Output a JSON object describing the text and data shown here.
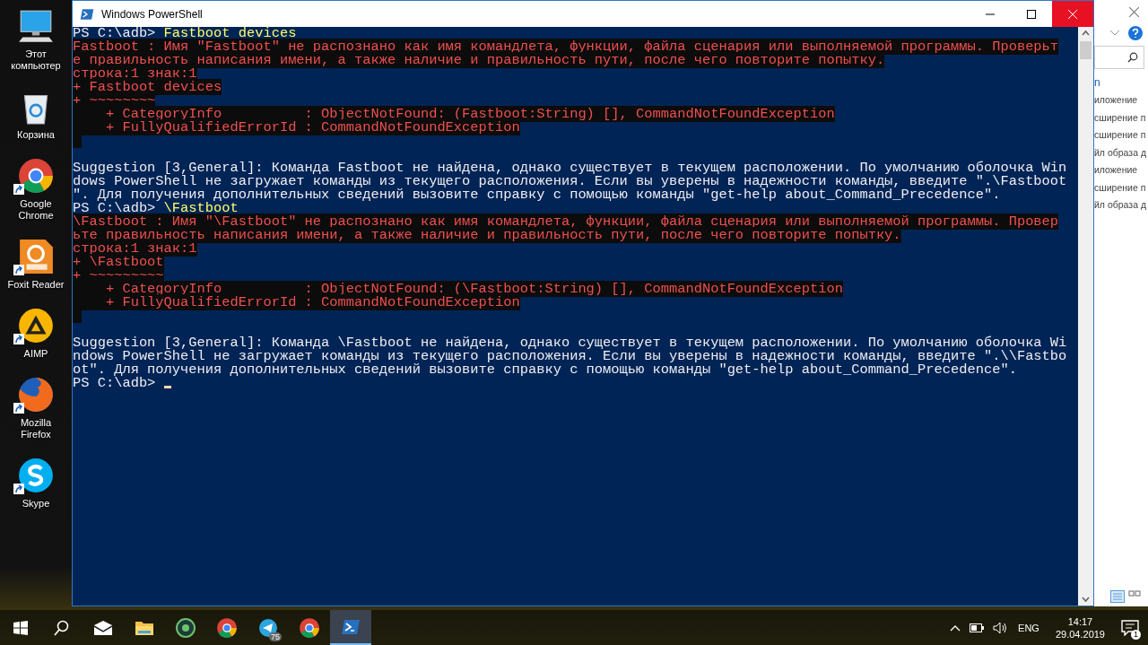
{
  "desktop": {
    "icons": [
      {
        "label": "Этот компьютер",
        "kind": "computer",
        "shortcut": false
      },
      {
        "label": "Корзина",
        "kind": "recycle",
        "shortcut": false
      },
      {
        "label": "Google Chrome",
        "kind": "chrome",
        "shortcut": true
      },
      {
        "label": "Foxit Reader",
        "kind": "pdf",
        "shortcut": true
      },
      {
        "label": "AIMP",
        "kind": "aimp",
        "shortcut": true
      },
      {
        "label": "Mozilla Firefox",
        "kind": "firefox",
        "shortcut": true
      },
      {
        "label": "Skype",
        "kind": "skype",
        "shortcut": true
      }
    ]
  },
  "window": {
    "title": "Windows PowerShell"
  },
  "console": {
    "lines": [
      {
        "kind": "prompt",
        "prompt": "PS C:\\adb>",
        "command": "Fastboot devices"
      },
      {
        "kind": "error",
        "text": "Fastboot : Имя \"Fastboot\" не распознано как имя командлета, функции, файла сценария или выполняемой программы. Проверьт"
      },
      {
        "kind": "error",
        "text": "е правильность написания имени, а также наличие и правильность пути, после чего повторите попытку."
      },
      {
        "kind": "error",
        "text": "строка:1 знак:1"
      },
      {
        "kind": "error",
        "text": "+ Fastboot devices"
      },
      {
        "kind": "error",
        "text": "+ ~~~~~~~~"
      },
      {
        "kind": "error",
        "text": "    + CategoryInfo          : ObjectNotFound: (Fastboot:String) [], CommandNotFoundException"
      },
      {
        "kind": "error",
        "text": "    + FullyQualifiedErrorId : CommandNotFoundException"
      },
      {
        "kind": "error-gap"
      },
      {
        "kind": "blank"
      },
      {
        "kind": "output",
        "text": "Suggestion [3,General]: Команда Fastboot не найдена, однако существует в текущем расположении. По умолчанию оболочка Win"
      },
      {
        "kind": "output",
        "text": "dows PowerShell не загружает команды из текущего расположения. Если вы уверены в надежности команды, введите \".\\Fastboot"
      },
      {
        "kind": "output",
        "text": "\". Для получения дополнительных сведений вызовите справку с помощью команды \"get-help about_Command_Precedence\"."
      },
      {
        "kind": "prompt",
        "prompt": "PS C:\\adb>",
        "command": "\\Fastboot"
      },
      {
        "kind": "error",
        "text": "\\Fastboot : Имя \"\\Fastboot\" не распознано как имя командлета, функции, файла сценария или выполняемой программы. Провер"
      },
      {
        "kind": "error",
        "text": "ьте правильность написания имени, а также наличие и правильность пути, после чего повторите попытку."
      },
      {
        "kind": "error",
        "text": "строка:1 знак:1"
      },
      {
        "kind": "error",
        "text": "+ \\Fastboot"
      },
      {
        "kind": "error",
        "text": "+ ~~~~~~~~~"
      },
      {
        "kind": "error",
        "text": "    + CategoryInfo          : ObjectNotFound: (\\Fastboot:String) [], CommandNotFoundException"
      },
      {
        "kind": "error",
        "text": "    + FullyQualifiedErrorId : CommandNotFoundException"
      },
      {
        "kind": "error-gap"
      },
      {
        "kind": "blank"
      },
      {
        "kind": "output",
        "text": "Suggestion [3,General]: Команда \\Fastboot не найдена, однако существует в текущем расположении. По умолчанию оболочка Wi"
      },
      {
        "kind": "output",
        "text": "ndows PowerShell не загружает команды из текущего расположения. Если вы уверены в надежности команды, введите \".\\\\Fastbo"
      },
      {
        "kind": "output",
        "text": "ot\". Для получения дополнительных сведений вызовите справку с помощью команды \"get-help about_Command_Precedence\"."
      },
      {
        "kind": "prompt",
        "prompt": "PS C:\\adb>",
        "cursor": true
      }
    ]
  },
  "background_window": {
    "link": "n",
    "items": [
      "иложение",
      "сширение п",
      "сширение п",
      "йл образа д",
      "иложение",
      "сширение п",
      "йл образа д"
    ]
  },
  "taskbar": {
    "apps": [
      {
        "kind": "start",
        "selected": false
      },
      {
        "kind": "search",
        "selected": false
      },
      {
        "kind": "mail",
        "selected": false
      },
      {
        "kind": "folder",
        "selected": false
      },
      {
        "kind": "android",
        "selected": false
      },
      {
        "kind": "chrome",
        "selected": false
      },
      {
        "kind": "telegram",
        "selected": false,
        "badge": "75"
      },
      {
        "kind": "chrome",
        "selected": false
      },
      {
        "kind": "powershell",
        "selected": true
      }
    ],
    "tray": {
      "language": "ENG",
      "time": "14:17",
      "date": "29.04.2019",
      "notifications": "1"
    }
  }
}
